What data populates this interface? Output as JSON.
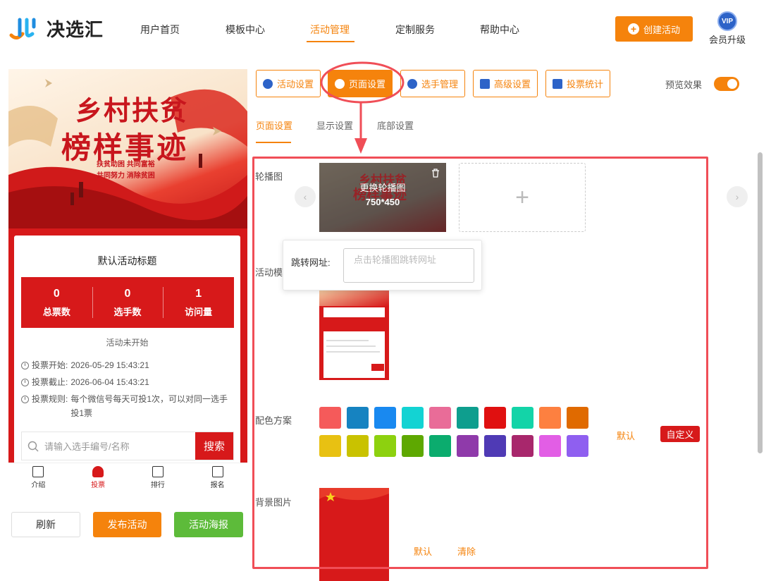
{
  "header": {
    "logo_text": "决选汇",
    "nav": [
      "用户首页",
      "模板中心",
      "活动管理",
      "定制服务",
      "帮助中心"
    ],
    "active_nav": "活动管理",
    "create_button": "创建活动",
    "vip_badge": "VIP",
    "vip_label": "会员升级"
  },
  "preview": {
    "banner_title_1": "乡村扶贫",
    "banner_title_2": "榜样事迹",
    "banner_sub_1": "扶贫助困 共同富裕",
    "banner_sub_2": "共同努力 消除贫困",
    "activity_title": "默认活动标题",
    "stats": [
      {
        "value": "0",
        "label": "总票数"
      },
      {
        "value": "0",
        "label": "选手数"
      },
      {
        "value": "1",
        "label": "访问量"
      }
    ],
    "status": "活动未开始",
    "vote_start_label": "投票开始:",
    "vote_start": "2026-05-29 15:43:21",
    "vote_end_label": "投票截止:",
    "vote_end": "2026-06-04 15:43:21",
    "vote_rule_label": "投票规则:",
    "vote_rule": "每个微信号每天可投1次，可以对同一选手投1票",
    "search_placeholder": "请输入选手编号/名称",
    "search_button": "搜索",
    "tabs": [
      "介绍",
      "投票",
      "排行",
      "报名"
    ],
    "active_tab": "投票"
  },
  "bottom_buttons": {
    "refresh": "刷新",
    "publish": "发布活动",
    "poster": "活动海报"
  },
  "toolbar": {
    "buttons": [
      "活动设置",
      "页面设置",
      "选手管理",
      "高级设置",
      "投票统计"
    ],
    "active": "页面设置",
    "preview_label": "预览效果",
    "preview_on": true
  },
  "subtabs": [
    "页面设置",
    "显示设置",
    "底部设置"
  ],
  "settings": {
    "carousel_label": "轮播图",
    "carousel_replace": "更换轮播图",
    "carousel_size": "750*450",
    "jump_label": "跳转网址:",
    "jump_placeholder": "点击轮播图跳转网址",
    "template_label": "活动模",
    "color_label": "配色方案",
    "colors": [
      "#f55a5a",
      "#1683c1",
      "#1989f0",
      "#13d3d3",
      "#e96c98",
      "#0e9e8e",
      "#e01010",
      "#13d4a8",
      "#fd8040",
      "#e06a00",
      "#e8c112",
      "#c9c200",
      "#8dd10f",
      "#5ea801",
      "#0bac6e",
      "#8f3aaa",
      "#4f3ab5",
      "#a8276c",
      "#e25ee5",
      "#8f5ff0"
    ],
    "color_default": "默认",
    "color_custom": "自定义",
    "bg_label": "背景图片",
    "bg_default": "默认",
    "bg_clear": "清除"
  }
}
